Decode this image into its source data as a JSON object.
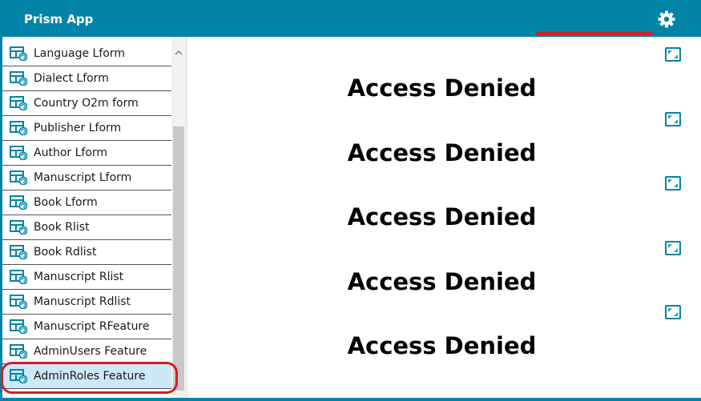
{
  "header": {
    "app_title": "Prism App",
    "settings_icon": "gear-icon",
    "accent_color": "#0284a8",
    "highlight_color": "#d0202a"
  },
  "sidebar": {
    "item_icon": "form-grid-refresh-icon",
    "selected_index": 13,
    "items": [
      {
        "label": "Language Lform"
      },
      {
        "label": "Dialect Lform"
      },
      {
        "label": "Country O2m form"
      },
      {
        "label": "Publisher Lform"
      },
      {
        "label": "Author Lform"
      },
      {
        "label": "Manuscript Lform"
      },
      {
        "label": "Book Lform"
      },
      {
        "label": "Book Rlist"
      },
      {
        "label": "Book Rdlist"
      },
      {
        "label": "Manuscript Rlist"
      },
      {
        "label": "Manuscript Rdlist"
      },
      {
        "label": "Manuscript RFeature"
      },
      {
        "label": "AdminUsers Feature"
      },
      {
        "label": "AdminRoles Feature"
      }
    ]
  },
  "main": {
    "expand_icon": "expand-icon",
    "panels": [
      {
        "message": "Access Denied"
      },
      {
        "message": "Access Denied"
      },
      {
        "message": "Access Denied"
      },
      {
        "message": "Access Denied"
      },
      {
        "message": "Access Denied"
      }
    ]
  }
}
